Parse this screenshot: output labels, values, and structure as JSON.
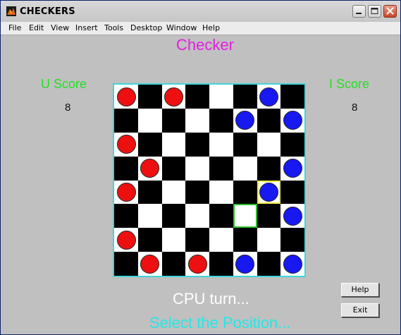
{
  "window": {
    "title": "CHECKERS",
    "menu": [
      "File",
      "Edit",
      "View",
      "Insert",
      "Tools",
      "Desktop",
      "Window",
      "Help"
    ]
  },
  "game": {
    "heading": "Checker",
    "u_score_label": "U Score",
    "u_score": "8",
    "i_score_label": "I Score",
    "i_score": "8",
    "turn_status": "CPU turn...",
    "prompt": "Select the Position...",
    "help_label": "Help",
    "exit_label": "Exit"
  },
  "board": {
    "size": 8,
    "pieces": [
      {
        "row": 0,
        "col": 0,
        "color": "red"
      },
      {
        "row": 0,
        "col": 2,
        "color": "red"
      },
      {
        "row": 0,
        "col": 6,
        "color": "blue"
      },
      {
        "row": 1,
        "col": 5,
        "color": "blue"
      },
      {
        "row": 1,
        "col": 7,
        "color": "blue"
      },
      {
        "row": 2,
        "col": 0,
        "color": "red"
      },
      {
        "row": 3,
        "col": 1,
        "color": "red"
      },
      {
        "row": 3,
        "col": 7,
        "color": "blue"
      },
      {
        "row": 4,
        "col": 0,
        "color": "red"
      },
      {
        "row": 4,
        "col": 6,
        "color": "blue"
      },
      {
        "row": 5,
        "col": 7,
        "color": "blue"
      },
      {
        "row": 6,
        "col": 0,
        "color": "red"
      },
      {
        "row": 7,
        "col": 1,
        "color": "red"
      },
      {
        "row": 7,
        "col": 3,
        "color": "red"
      },
      {
        "row": 7,
        "col": 5,
        "color": "blue"
      },
      {
        "row": 7,
        "col": 7,
        "color": "blue"
      }
    ],
    "highlights": [
      {
        "row": 4,
        "col": 6,
        "kind": "selected"
      },
      {
        "row": 5,
        "col": 5,
        "kind": "target"
      }
    ]
  },
  "colors": {
    "heading": "#e020e0",
    "score_label": "#22e022",
    "status": "#ffffff",
    "prompt": "#22e8e8",
    "board_border": "#3fd6d6",
    "red_piece": "#ee1010",
    "blue_piece": "#1818f0",
    "selected_outline": "#f2ec46",
    "target_outline": "#2bbf2b"
  }
}
